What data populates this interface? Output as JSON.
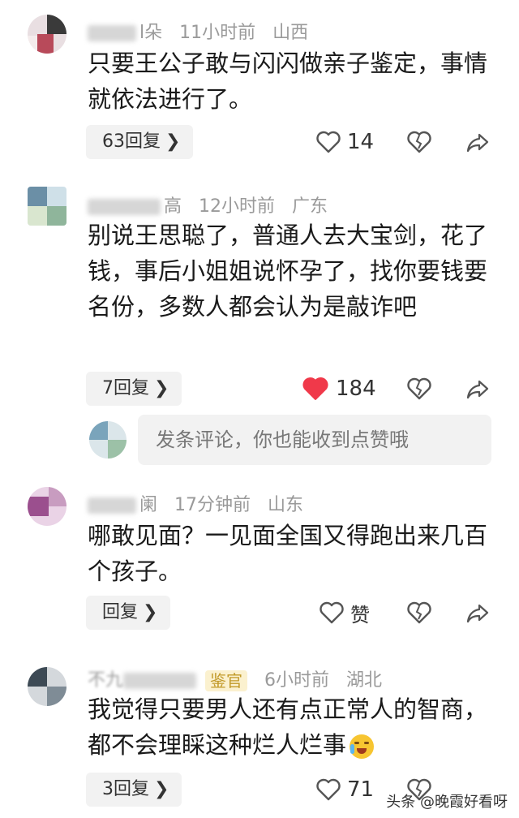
{
  "comments": [
    {
      "name_visible": "l朵",
      "time": "11小时前",
      "location": "山西",
      "text": "只要王公子敢与闪闪做亲子鉴定，事情就依法进行了。",
      "replies": "63回复",
      "likes": "14"
    },
    {
      "name_visible": "高",
      "time": "12小时前",
      "location": "广东",
      "text": "别说王思聪了，普通人去大宝剑，花了钱，事后小姐姐说怀孕了，找你要钱要名份，多数人都会认为是敲诈吧",
      "replies": "7回复",
      "likes": "184"
    },
    {
      "name_visible": "阑",
      "time": "17分钟前",
      "location": "山东",
      "text": "哪敢见面？一见面全国又得跑出来几百个孩子。",
      "replies": "回复",
      "likes": "赞"
    },
    {
      "name_visible": "不九",
      "badge": "鉴官",
      "time": "6小时前",
      "location": "湖北",
      "text": "我觉得只要男人还有点正常人的智商，都不会理睬这种烂人烂事",
      "replies": "3回复",
      "likes": "71"
    }
  ],
  "input_placeholder": "发条评论，你也能收到点赞哦",
  "watermark": "头条 @晚霞好看呀",
  "colors": {
    "liked": "#f0394a",
    "icon": "#555555",
    "reply_bg": "#f2f2f2"
  }
}
